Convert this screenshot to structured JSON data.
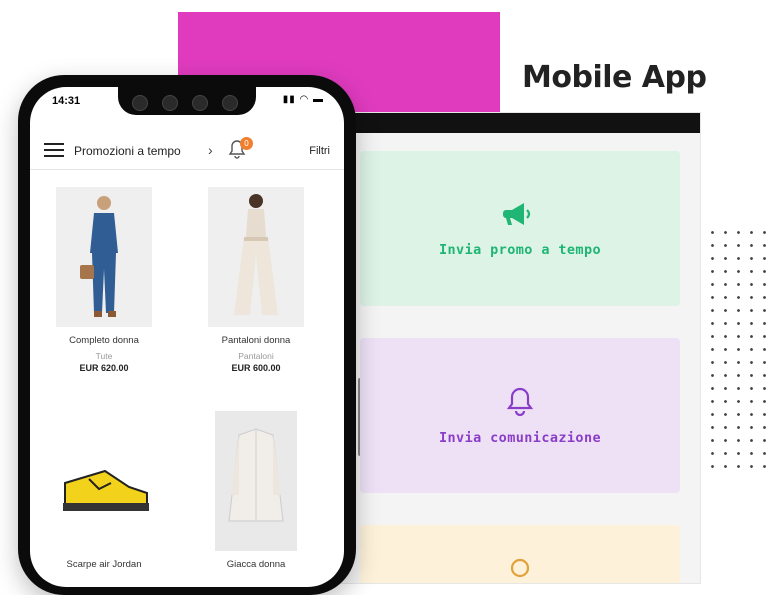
{
  "promo": {
    "title": "Mobile App"
  },
  "phone": {
    "status": {
      "time": "14:31"
    },
    "nav": {
      "title": "Promozioni a tempo",
      "badge": "0",
      "filters": "Filtri"
    },
    "products": [
      {
        "name": "Completo donna",
        "category": "Tute",
        "price": "EUR 620.00"
      },
      {
        "name": "Pantaloni donna",
        "category": "Pantaloni",
        "price": "EUR 600.00"
      },
      {
        "name": "Scarpe air Jordan",
        "category": "",
        "price": ""
      },
      {
        "name": "Giacca donna",
        "category": "",
        "price": ""
      }
    ]
  },
  "panel": {
    "cards": [
      {
        "label": "Invia promo a tempo",
        "icon": "megaphone-icon",
        "color": "#1fb574"
      },
      {
        "label": "Invia comunicazione",
        "icon": "bell-icon",
        "color": "#8a3ec8"
      },
      {
        "label": "",
        "icon": "search-icon",
        "color": "#e1a13b"
      }
    ]
  }
}
